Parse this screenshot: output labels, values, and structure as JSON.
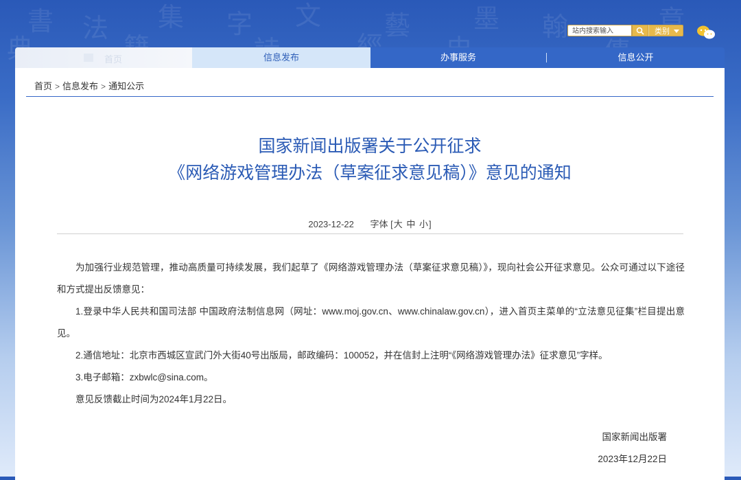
{
  "header": {
    "search_placeholder": "站内搜索输入",
    "category_label": "类别",
    "wechat_icon": "wechat-icon"
  },
  "nav": {
    "home_label": "首页",
    "items": [
      {
        "label": "信息发布",
        "active": true
      },
      {
        "label": "办事服务",
        "active": false
      },
      {
        "label": "信息公开",
        "active": false
      }
    ]
  },
  "breadcrumb": {
    "items": [
      "首页",
      "信息发布",
      "通知公示"
    ],
    "separator": ">"
  },
  "article": {
    "title_line1": "国家新闻出版署关于公开征求",
    "title_line2": "《网络游戏管理办法（草案征求意见稿）》意见的通知",
    "date": "2023-12-22",
    "font_size_label": "字体 [",
    "font_size_options": [
      "大",
      "中",
      "小"
    ],
    "font_size_close": "]",
    "paragraphs": [
      "为加强行业规范管理，推动高质量可持续发展，我们起草了《网络游戏管理办法（草案征求意见稿）》，现向社会公开征求意见。公众可通过以下途径和方式提出反馈意见：",
      "1.登录中华人民共和国司法部 中国政府法制信息网（网址：www.moj.gov.cn、www.chinalaw.gov.cn），进入首页主菜单的“立法意见征集”栏目提出意见。",
      "2.通信地址：北京市西城区宣武门外大街40号出版局，邮政编码：100052，并在信封上注明“《网络游戏管理办法》征求意见”字样。",
      "3.电子邮箱：zxbwlc@sina.com。",
      "意见反馈截止时间为2024年1月22日。"
    ],
    "signature": "国家新闻出版署",
    "signature_date": "2023年12月22日"
  },
  "colors": {
    "brand_blue": "#3467c7",
    "title_blue": "#2b5bb5",
    "accent_gold": "#e7b94b"
  }
}
